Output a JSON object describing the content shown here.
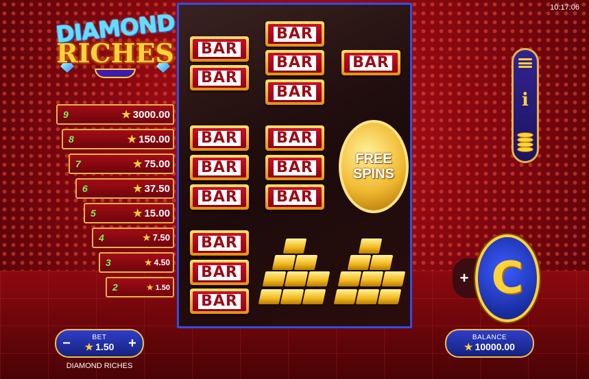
{
  "status": {
    "time": "10:17:06"
  },
  "logo": {
    "line1": "DIAMOND",
    "line2": "RICHES"
  },
  "paytable": [
    {
      "count": "9",
      "value": "3000.00"
    },
    {
      "count": "8",
      "value": "150.00"
    },
    {
      "count": "7",
      "value": "75.00"
    },
    {
      "count": "6",
      "value": "37.50"
    },
    {
      "count": "5",
      "value": "15.00"
    },
    {
      "count": "4",
      "value": "7.50"
    },
    {
      "count": "3",
      "value": "4.50"
    },
    {
      "count": "2",
      "value": "1.50"
    }
  ],
  "reels": {
    "bar_label": "BAR",
    "free_spins": {
      "line1": "FREE",
      "line2": "SPINS"
    }
  },
  "side_menu": {
    "icons": [
      "menu-icon",
      "info-icon",
      "coins-icon"
    ],
    "info_glyph": "i"
  },
  "spin": {
    "plus_glyph": "+",
    "spin_glyph": "C"
  },
  "bet": {
    "label": "BET",
    "value": "1.50",
    "minus": "−",
    "plus": "+"
  },
  "balance": {
    "label": "BALANCE",
    "value": "10000.00"
  },
  "game_name": "DIAMOND RICHES",
  "star_glyph": "★",
  "colors": {
    "accent": "#ffd23a",
    "panel_blue": "#1c1460",
    "background_red": "#8a0810",
    "count_green": "#79f05f"
  }
}
